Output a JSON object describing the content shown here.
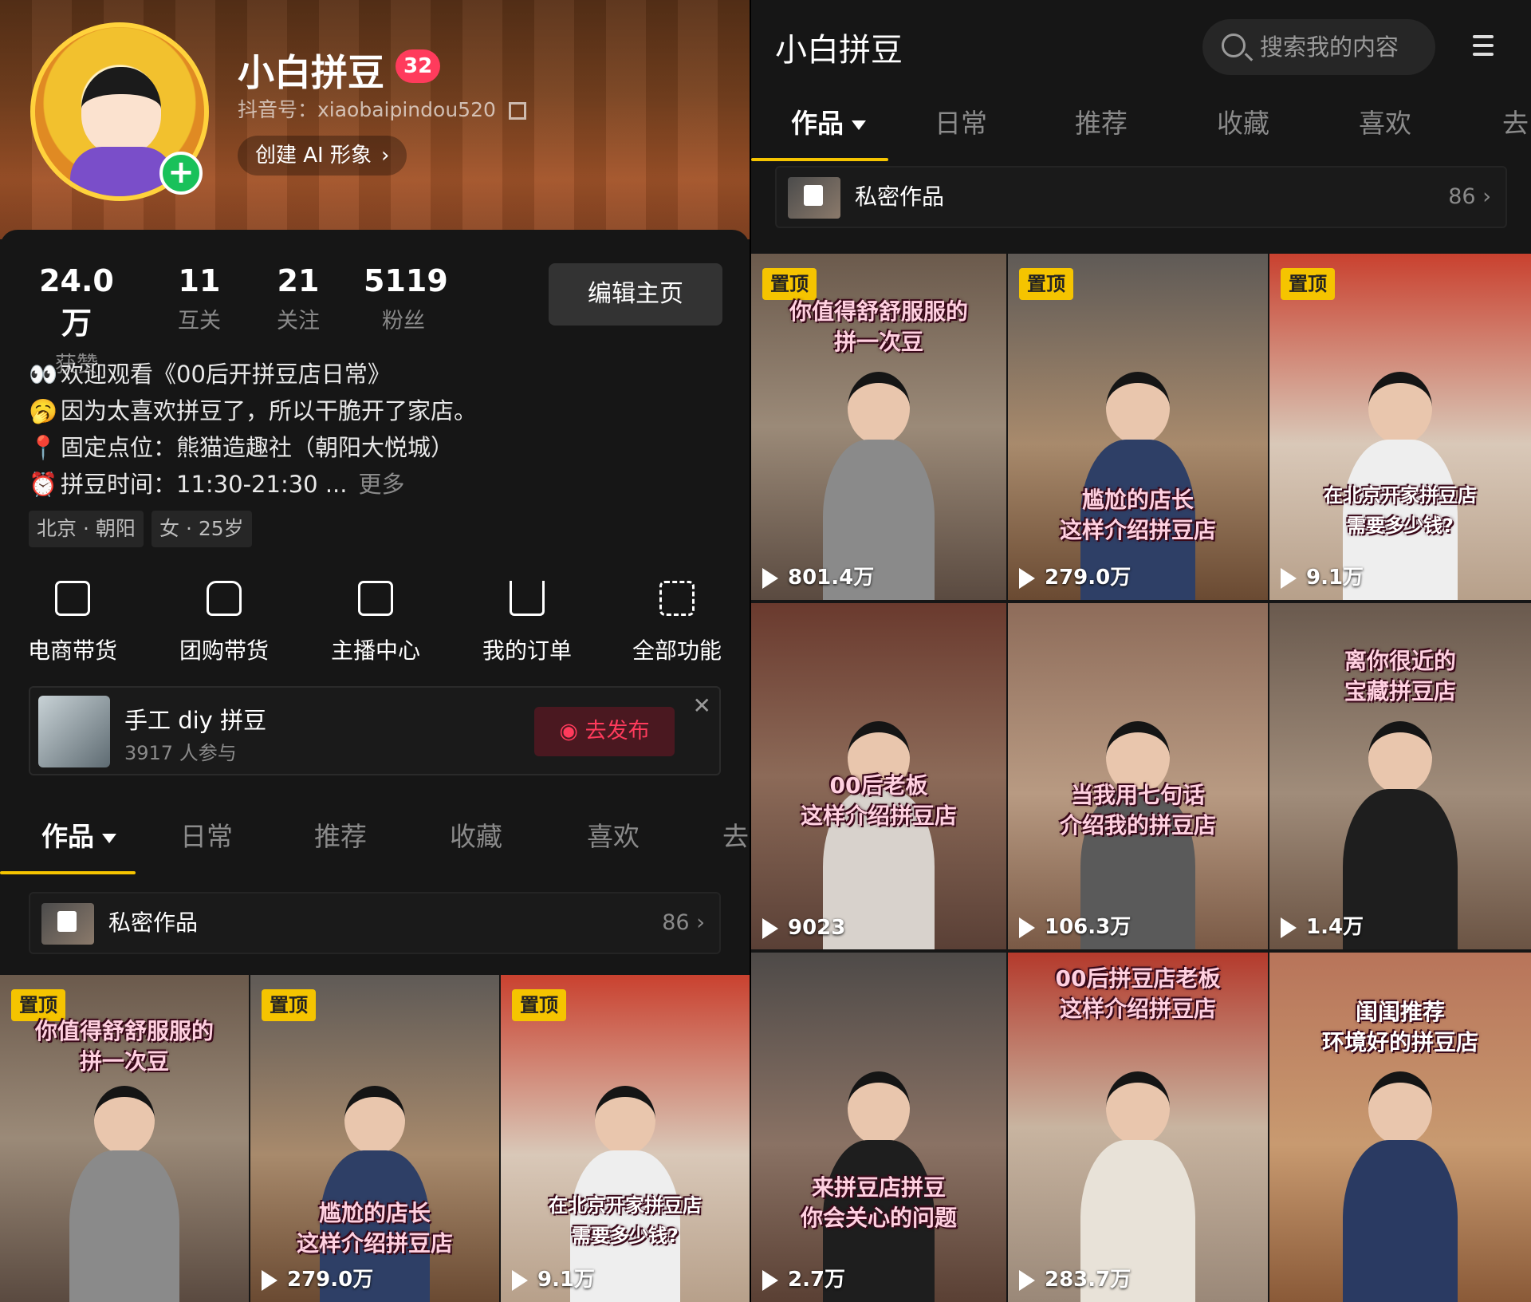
{
  "left": {
    "profile": {
      "name": "小白拼豆",
      "level": "32",
      "douyin_id": "抖音号：xiaobaipindou520",
      "ai_button": "创建 AI 形象"
    },
    "stats": [
      {
        "num": "24.0万",
        "label": "获赞"
      },
      {
        "num": "11",
        "label": "互关"
      },
      {
        "num": "21",
        "label": "关注"
      },
      {
        "num": "5119",
        "label": "粉丝"
      }
    ],
    "edit_button": "编辑主页",
    "bio": [
      {
        "icon": "👀",
        "text": "欢迎观看《00后开拼豆店日常》"
      },
      {
        "icon": "🥱",
        "text": "因为太喜欢拼豆了，所以干脆开了家店。"
      },
      {
        "icon": "📍",
        "text": "固定点位：熊猫造趣社（朝阳大悦城）"
      },
      {
        "icon": "⏰",
        "text": "拼豆时间：11:30-21:30 ..."
      }
    ],
    "bio_more": "更多",
    "tags": [
      "北京 · 朝阳",
      "女 · 25岁"
    ],
    "functions": [
      {
        "icon": "shopping-bag-icon",
        "label": "电商带货"
      },
      {
        "icon": "group-buy-icon",
        "label": "团购带货"
      },
      {
        "icon": "live-tv-icon",
        "label": "主播中心"
      },
      {
        "icon": "cart-icon",
        "label": "我的订单"
      },
      {
        "icon": "grid-apps-icon",
        "label": "全部功能"
      }
    ],
    "promo": {
      "title": "手工 diy 拼豆",
      "subtitle": "3917 人参与",
      "button": "去发布",
      "close": "✕"
    },
    "tabs": [
      "作品",
      "日常",
      "推荐",
      "收藏",
      "喜欢",
      "去"
    ],
    "private": {
      "label": "私密作品",
      "count": "86 ›"
    },
    "videos": [
      {
        "pin": "置顶",
        "caption": [
          "你值得舒舒服服的",
          "拼一次豆"
        ],
        "views": "801.4万"
      },
      {
        "pin": "置顶",
        "caption": [
          "尴尬的店长",
          "这样介绍拼豆店"
        ],
        "views": "279.0万"
      },
      {
        "pin": "置顶",
        "caption": [
          "在北京开家拼豆店",
          "需要多少钱?"
        ],
        "views": "9.1万"
      }
    ]
  },
  "right": {
    "title": "小白拼豆",
    "search_placeholder": "搜索我的内容",
    "tabs": [
      "作品",
      "日常",
      "推荐",
      "收藏",
      "喜欢",
      "去"
    ],
    "private": {
      "label": "私密作品",
      "count": "86 ›"
    },
    "videos": [
      {
        "pin": "置顶",
        "caption": [
          "你值得舒舒服服的",
          "拼一次豆"
        ],
        "views": "801.4万"
      },
      {
        "pin": "置顶",
        "caption": [
          "尴尬的店长",
          "这样介绍拼豆店"
        ],
        "views": "279.0万"
      },
      {
        "pin": "置顶",
        "caption": [
          "在北京开家拼豆店",
          "需要多少钱?"
        ],
        "views": "9.1万"
      },
      {
        "pin": "",
        "caption": [
          "00后老板",
          "这样介绍拼豆店"
        ],
        "views": "9023"
      },
      {
        "pin": "",
        "caption": [
          "当我用七句话",
          "介绍我的拼豆店"
        ],
        "views": "106.3万"
      },
      {
        "pin": "",
        "caption": [
          "离你很近的",
          "宝藏拼豆店"
        ],
        "views": "1.4万"
      },
      {
        "pin": "",
        "caption": [
          "来拼豆店拼豆",
          "你会关心的问题"
        ],
        "views": "2.7万"
      },
      {
        "pin": "",
        "caption": [
          "00后拼豆店老板",
          "这样介绍拼豆店"
        ],
        "views": "283.7万"
      },
      {
        "pin": "",
        "caption": [
          "闺闺推荐",
          "环境好的拼豆店"
        ],
        "views": ""
      }
    ]
  },
  "colors": {
    "accent_yellow": "#f5c400",
    "brand_red": "#ff3b5c",
    "bg": "#161616"
  }
}
